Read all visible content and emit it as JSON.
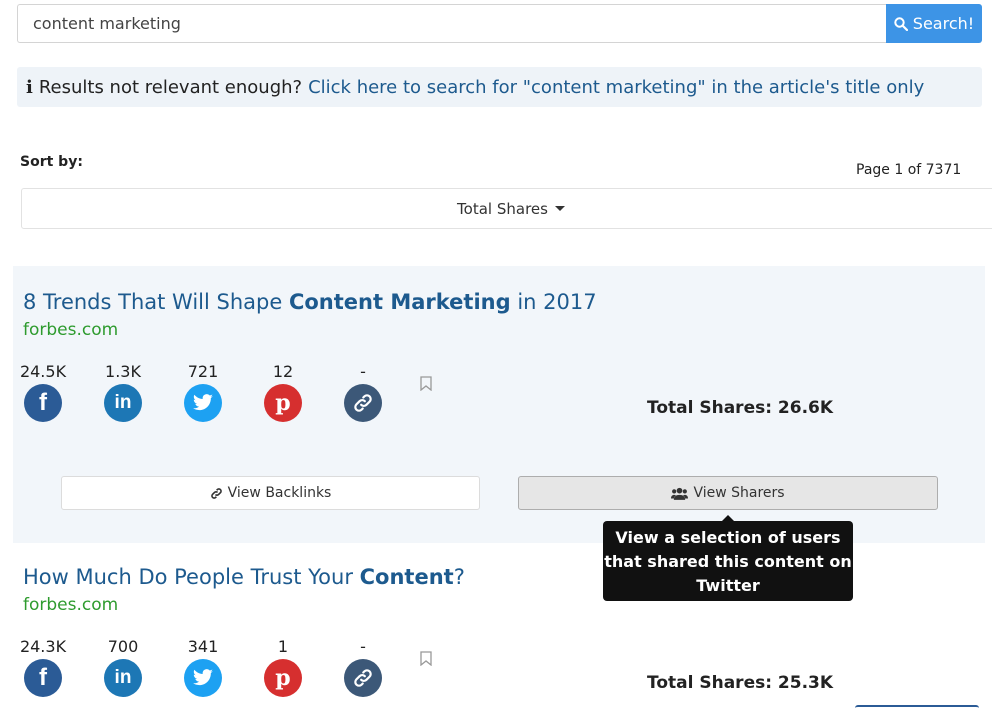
{
  "search": {
    "value": "content marketing",
    "button_label": "Search!"
  },
  "notice": {
    "icon": "info-icon",
    "text": "Results not relevant enough?",
    "link": "Click here to search for \"content marketing\" in the article's title only"
  },
  "sort": {
    "label": "Sort by:",
    "selected": "Total Shares"
  },
  "pagination": {
    "text": "Page 1 of 7371"
  },
  "results": [
    {
      "title_pre": "8 Trends That Will Shape ",
      "title_bold": "Content Marketing",
      "title_post": " in 2017",
      "domain": "forbes.com",
      "shares": {
        "facebook": "24.5K",
        "linkedin": "1.3K",
        "twitter": "721",
        "pinterest": "12",
        "links": "-"
      },
      "total_shares": "Total Shares: 26.6K",
      "backlinks_label": "View Backlinks",
      "sharers_label": "View Sharers"
    },
    {
      "title_pre": "How Much Do People Trust Your ",
      "title_bold": "Content",
      "title_post": "?",
      "domain": "forbes.com",
      "shares": {
        "facebook": "24.3K",
        "linkedin": "700",
        "twitter": "341",
        "pinterest": "1",
        "links": "-"
      },
      "total_shares": "Total Shares: 25.3K"
    }
  ],
  "tooltip": {
    "text": "View a selection of users that shared this content on Twitter"
  },
  "colors": {
    "accent": "#3d94e6",
    "title": "#1d5a8e",
    "domain": "#2e9b2e",
    "facebook": "#2b5b96",
    "linkedin": "#1d77b5",
    "twitter": "#1da1f2",
    "pinterest": "#d62f2f"
  }
}
